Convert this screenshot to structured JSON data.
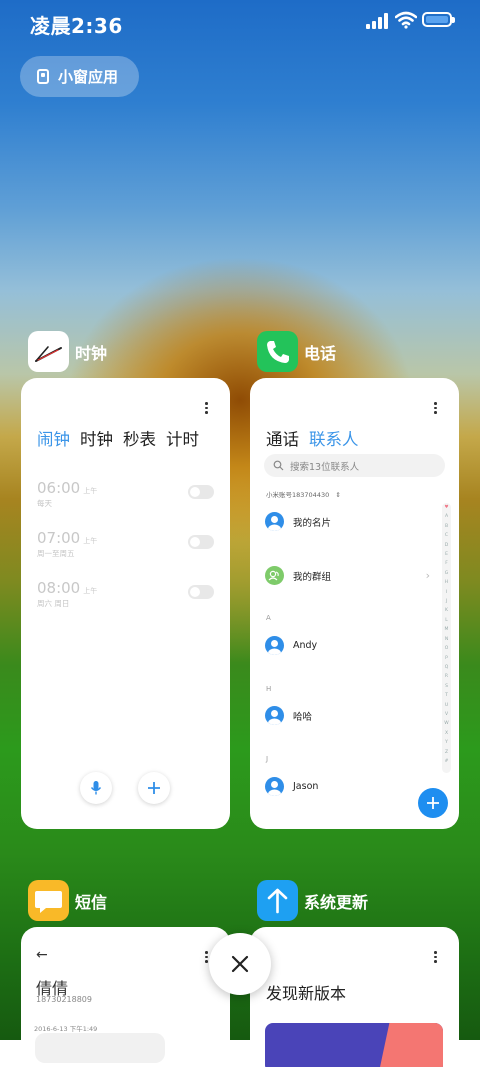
{
  "status_bar": {
    "time": "凌晨2:36"
  },
  "floating_window": {
    "label": "小窗应用"
  },
  "clock_card": {
    "app_name": "时钟",
    "tabs": [
      "闹钟",
      "时钟",
      "秒表",
      "计时"
    ],
    "alarms": [
      {
        "time": "06:00",
        "ampm": "上午",
        "repeat": "每天"
      },
      {
        "time": "07:00",
        "ampm": "上午",
        "repeat": "周一至周五"
      },
      {
        "time": "08:00",
        "ampm": "上午",
        "repeat": "周六 周日"
      }
    ]
  },
  "phone_card": {
    "app_name": "电话",
    "tabs": [
      "通话",
      "联系人"
    ],
    "search_placeholder": "搜索13位联系人",
    "account": "小米账号183704430",
    "my_card": "我的名片",
    "my_groups": "我的群组",
    "sections": [
      {
        "letter": "A",
        "name": "Andy"
      },
      {
        "letter": "H",
        "name": "哈哈"
      },
      {
        "letter": "J",
        "name": "Jason"
      }
    ],
    "index_letters": [
      "♥",
      "A",
      "B",
      "C",
      "D",
      "E",
      "F",
      "G",
      "H",
      "I",
      "J",
      "K",
      "L",
      "M",
      "N",
      "O",
      "P",
      "Q",
      "R",
      "S",
      "T",
      "U",
      "V",
      "W",
      "X",
      "Y",
      "Z",
      "#"
    ]
  },
  "sms_card": {
    "app_name": "短信",
    "contact_name": "倩倩",
    "contact_number": "18730218809",
    "date": "2016-6-13 下午1:49"
  },
  "update_card": {
    "app_name": "系统更新",
    "title": "发现新版本"
  },
  "colors": {
    "accent": "#3b95e8",
    "fab": "#1e8ef0",
    "phone_icon": "#23c35a",
    "sms_icon": "#f9b928",
    "update_icon": "#1ea0f2"
  }
}
